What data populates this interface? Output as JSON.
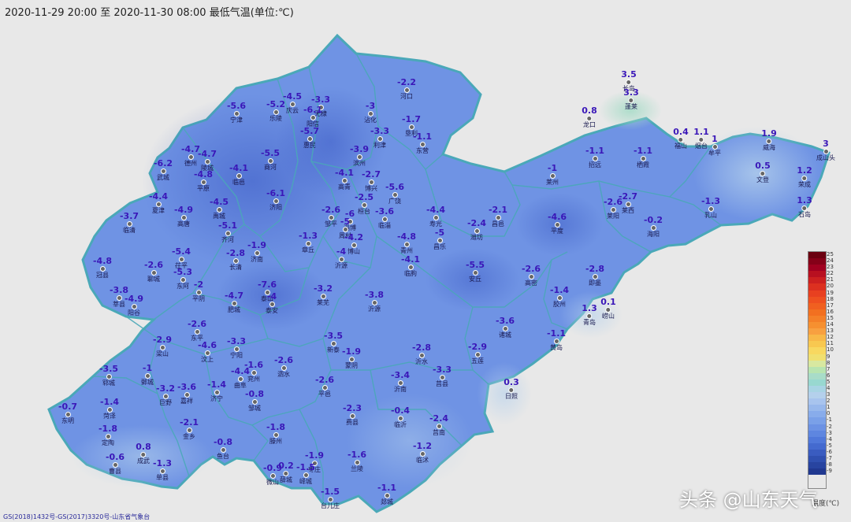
{
  "title": "2020-11-29 20:00 至 2020-11-30 08:00 最低气温(单位:℃)",
  "footer": "GS(2018)1432号-GS(2017)3320号-山东省气象台",
  "watermark": "头条 @山东天气",
  "legend": {
    "unit": "温度(℃)",
    "labels": [
      "25",
      "24",
      "23",
      "22",
      "21",
      "20",
      "19",
      "18",
      "17",
      "16",
      "15",
      "14",
      "13",
      "12",
      "11",
      "10",
      "9",
      "8",
      "7",
      "6",
      "5",
      "4",
      "3",
      "2",
      "1",
      "0",
      "-1",
      "-2",
      "-3",
      "-4",
      "-5",
      "-6",
      "-7",
      "-8",
      "-9"
    ],
    "colors": [
      "#6b0010",
      "#850018",
      "#a00020",
      "#b81020",
      "#cc2020",
      "#dc3020",
      "#e84020",
      "#ee5020",
      "#f06020",
      "#f27020",
      "#f48028",
      "#f69030",
      "#f8a040",
      "#f8b848",
      "#f8c850",
      "#f8d860",
      "#f0e070",
      "#d8e8a0",
      "#b8e4b0",
      "#a8dcc8",
      "#98d8d0",
      "#a8d4e4",
      "#b4d0ec",
      "#a8c4ee",
      "#98b8ec",
      "#88aceb",
      "#7aa0e8",
      "#6c92e4",
      "#5e86e0",
      "#5078da",
      "#446acf",
      "#3a5cc0",
      "#3050b0",
      "#2844a0",
      "#203890"
    ]
  },
  "stations": [
    {
      "v": "-5.6",
      "n": "宁津"
    },
    {
      "v": "-5.2",
      "n": "乐陵"
    },
    {
      "v": "-4.5",
      "n": "庆云"
    },
    {
      "v": "-3.3",
      "n": "无棣"
    },
    {
      "v": "-6.1",
      "n": "阳信"
    },
    {
      "v": "-2.2",
      "n": "河口"
    },
    {
      "v": "-3",
      "n": "沾化"
    },
    {
      "v": "-5.7",
      "n": "惠民"
    },
    {
      "v": "-1.7",
      "n": "垦利"
    },
    {
      "v": "-3.3",
      "n": "利津"
    },
    {
      "v": "-1.1",
      "n": "东营"
    },
    {
      "v": "-4.7",
      "n": "德州"
    },
    {
      "v": "-4.7",
      "n": "陵城"
    },
    {
      "v": "-6.2",
      "n": "武城"
    },
    {
      "v": "-4.8",
      "n": "平原"
    },
    {
      "v": "-4.1",
      "n": "临邑"
    },
    {
      "v": "-5.5",
      "n": "商河"
    },
    {
      "v": "-3.9",
      "n": "滨州"
    },
    {
      "v": "-4.1",
      "n": "高青"
    },
    {
      "v": "-2.7",
      "n": "博兴"
    },
    {
      "v": "-5.6",
      "n": "广饶"
    },
    {
      "v": "-4.4",
      "n": "夏津"
    },
    {
      "v": "-6.1",
      "n": "济阳"
    },
    {
      "v": "-2.5",
      "n": "桓台"
    },
    {
      "v": "-4.5",
      "n": "禹城"
    },
    {
      "v": "-4.9",
      "n": "高唐"
    },
    {
      "v": "-3.7",
      "n": "临清"
    },
    {
      "v": "-2.6",
      "n": "邹平"
    },
    {
      "v": "-6",
      "n": "淄博"
    },
    {
      "v": "-5",
      "n": "周村"
    },
    {
      "v": "-3.6",
      "n": "临淄"
    },
    {
      "v": "-4.4",
      "n": "寿光"
    },
    {
      "v": "-2.4",
      "n": "潍坊"
    },
    {
      "v": "-2.1",
      "n": "昌邑"
    },
    {
      "v": "-5.1",
      "n": "齐河"
    },
    {
      "v": "-1.9",
      "n": "济南"
    },
    {
      "v": "-1.3",
      "n": "章丘"
    },
    {
      "v": "-4.2",
      "n": "博山"
    },
    {
      "v": "-4.8",
      "n": "青州"
    },
    {
      "v": "-5",
      "n": "昌乐"
    },
    {
      "v": "-4.8",
      "n": "冠县"
    },
    {
      "v": "-2.6",
      "n": "聊城"
    },
    {
      "v": "-5.4",
      "n": "茌平"
    },
    {
      "v": "-5.3",
      "n": "东阿"
    },
    {
      "v": "-2.8",
      "n": "长清"
    },
    {
      "v": "-4",
      "n": "沂源"
    },
    {
      "v": "-4.1",
      "n": "临朐"
    },
    {
      "v": "-5.5",
      "n": "安丘"
    },
    {
      "v": "-2.6",
      "n": "高密"
    },
    {
      "v": "-3.8",
      "n": "莘县"
    },
    {
      "v": "-4.9",
      "n": "阳谷"
    },
    {
      "v": "-2",
      "n": "平阴"
    },
    {
      "v": "-7.6",
      "n": "泰山"
    },
    {
      "v": "-4",
      "n": "泰安"
    },
    {
      "v": "-4.7",
      "n": "肥城"
    },
    {
      "v": "-3.2",
      "n": "莱芜"
    },
    {
      "v": "-3.8",
      "n": "沂源"
    },
    {
      "v": "-1.4",
      "n": "胶州"
    },
    {
      "v": "-2.8",
      "n": "即墨"
    },
    {
      "v": "-2.6",
      "n": "东平"
    },
    {
      "v": "-2.9",
      "n": "梁山"
    },
    {
      "v": "-4.6",
      "n": "汶上"
    },
    {
      "v": "-3.3",
      "n": "宁阳"
    },
    {
      "v": "-3.5",
      "n": "新泰"
    },
    {
      "v": "-1.9",
      "n": "蒙阴"
    },
    {
      "v": "-2.8",
      "n": "沂水"
    },
    {
      "v": "-2.9",
      "n": "五莲"
    },
    {
      "v": "-3.6",
      "n": "诸城"
    },
    {
      "v": "-1.1",
      "n": "黄岛"
    },
    {
      "v": "1.3",
      "n": "青岛"
    },
    {
      "v": "0.1",
      "n": "崂山"
    },
    {
      "v": "-3.5",
      "n": "郓城"
    },
    {
      "v": "-1",
      "n": "鄄城"
    },
    {
      "v": "-1.6",
      "n": "兖州"
    },
    {
      "v": "-4.4",
      "n": "曲阜"
    },
    {
      "v": "-2.6",
      "n": "泗水"
    },
    {
      "v": "-2.6",
      "n": "平邑"
    },
    {
      "v": "-3.4",
      "n": "沂南"
    },
    {
      "v": "-3.3",
      "n": "莒县"
    },
    {
      "v": "-3.2",
      "n": "巨野"
    },
    {
      "v": "-3.6",
      "n": "嘉祥"
    },
    {
      "v": "-1.4",
      "n": "济宁"
    },
    {
      "v": "-0.8",
      "n": "邹城"
    },
    {
      "v": "0.3",
      "n": "日照"
    },
    {
      "v": "-0.7",
      "n": "东明"
    },
    {
      "v": "-1.4",
      "n": "菏泽"
    },
    {
      "v": "-2.1",
      "n": "金乡"
    },
    {
      "v": "-2.3",
      "n": "费县"
    },
    {
      "v": "-0.4",
      "n": "临沂"
    },
    {
      "v": "-2.4",
      "n": "莒南"
    },
    {
      "v": "-1.8",
      "n": "定陶"
    },
    {
      "v": "-1.8",
      "n": "滕州"
    },
    {
      "v": "0.8",
      "n": "成武"
    },
    {
      "v": "-0.8",
      "n": "鱼台"
    },
    {
      "v": "-0.6",
      "n": "曹县"
    },
    {
      "v": "-1.3",
      "n": "单县"
    },
    {
      "v": "-1.6",
      "n": "兰陵"
    },
    {
      "v": "-1.2",
      "n": "临沭"
    },
    {
      "v": "-1.9",
      "n": "枣庄"
    },
    {
      "v": "-0.9",
      "n": "微山"
    },
    {
      "v": "0.2",
      "n": "薛城"
    },
    {
      "v": "-1.5",
      "n": "峄城"
    },
    {
      "v": "-1.5",
      "n": "台儿庄"
    },
    {
      "v": "-1.1",
      "n": "郯城"
    },
    {
      "v": "3.5",
      "n": "长岛"
    },
    {
      "v": "3.3",
      "n": "蓬莱"
    },
    {
      "v": "0.8",
      "n": "龙口"
    },
    {
      "v": "0.4",
      "n": "福山"
    },
    {
      "v": "1.1",
      "n": "烟台"
    },
    {
      "v": "1",
      "n": "牟平"
    },
    {
      "v": "1.9",
      "n": "威海"
    },
    {
      "v": "3",
      "n": "成山头"
    },
    {
      "v": "-1.1",
      "n": "招远"
    },
    {
      "v": "-1.1",
      "n": "栖霞"
    },
    {
      "v": "0.5",
      "n": "文登"
    },
    {
      "v": "1.2",
      "n": "荣成"
    },
    {
      "v": "-1",
      "n": "莱州"
    },
    {
      "v": "-2.6",
      "n": "莱阳"
    },
    {
      "v": "-2.7",
      "n": "莱西"
    },
    {
      "v": "-1.3",
      "n": "乳山"
    },
    {
      "v": "1.3",
      "n": "石岛"
    },
    {
      "v": "-4.6",
      "n": "平度"
    },
    {
      "v": "-0.2",
      "n": "海阳"
    }
  ]
}
